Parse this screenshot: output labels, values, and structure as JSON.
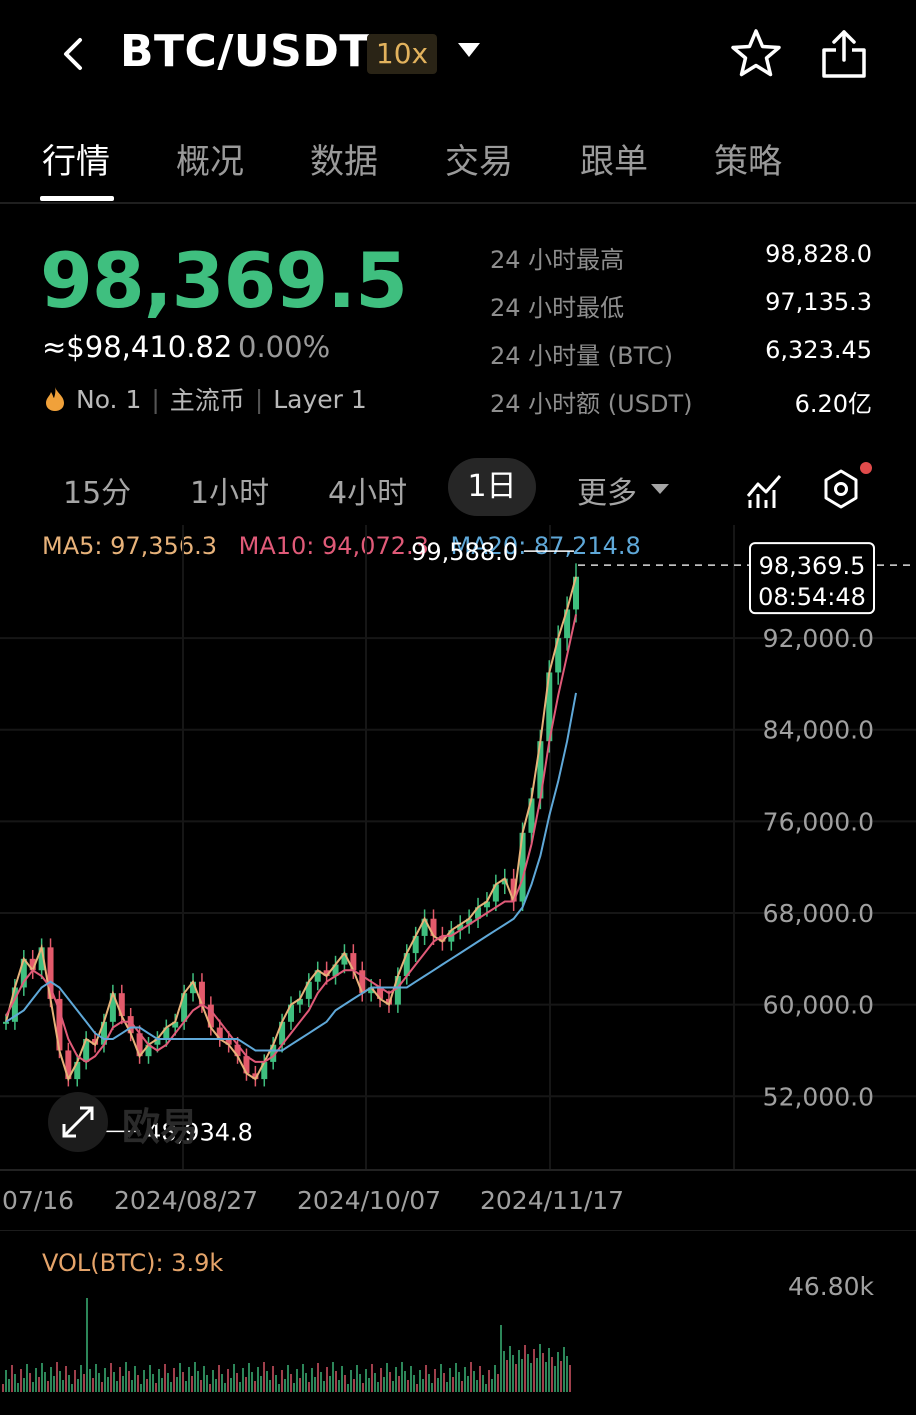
{
  "header": {
    "pair": "BTC/USDT",
    "leverage": "10x"
  },
  "tabs": [
    "行情",
    "概况",
    "数据",
    "交易",
    "跟单",
    "策略"
  ],
  "price": {
    "last": "98,369.5",
    "fiat": "≈$98,410.82",
    "change": "0.00%",
    "rank": "No. 1",
    "tag1": "主流币",
    "tag2": "Layer 1"
  },
  "stats": [
    {
      "label": "24 小时最高",
      "value": "98,828.0"
    },
    {
      "label": "24 小时最低",
      "value": "97,135.3"
    },
    {
      "label": "24 小时量 (BTC)",
      "value": "6,323.45"
    },
    {
      "label": "24 小时额 (USDT)",
      "value": "6.20亿"
    }
  ],
  "timeframes": {
    "m15": "15分",
    "h1": "1小时",
    "h4": "4小时",
    "d1": "1日",
    "more": "更多"
  },
  "ma": {
    "ma5": "MA5: 97,356.3",
    "ma10": "MA10: 94,072.3",
    "ma20": "MA20: 87,214.8"
  },
  "colors": {
    "up": "#3fbf7f",
    "down": "#e35a6b",
    "ma5": "#e7b27a",
    "ma10": "#e05a78",
    "ma20": "#5fa8d8",
    "accent": "#e2b25d"
  },
  "chart_data": {
    "type": "line",
    "title": "",
    "y_ticks": [
      "92,000.0",
      "84,000.0",
      "76,000.0",
      "68,000.0",
      "60,000.0",
      "52,000.0"
    ],
    "x_ticks": [
      "07/16",
      "2024/08/27",
      "2024/10/07",
      "2024/11/17"
    ],
    "ylim": [
      46000,
      101000
    ],
    "high_label": "99,588.0",
    "low_label": "48,934.8",
    "current_price": "98,369.5",
    "current_time": "08:54:48",
    "series": [
      {
        "name": "MA5",
        "values": [
          58500,
          61500,
          64000,
          63000,
          65000,
          60500,
          56000,
          53500,
          55000,
          57000,
          56500,
          58500,
          61000,
          59000,
          57500,
          55500,
          56500,
          57000,
          58000,
          58500,
          61000,
          62000,
          60000,
          58000,
          57000,
          56500,
          55500,
          54000,
          53500,
          55000,
          56500,
          58500,
          60000,
          60500,
          62000,
          63000,
          62500,
          63500,
          64500,
          63000,
          61000,
          61500,
          60500,
          60000,
          62500,
          64500,
          66000,
          67500,
          66000,
          65500,
          66500,
          67000,
          67500,
          68500,
          69000,
          70500,
          71000,
          69000,
          75000,
          78000,
          83000,
          89000,
          92000,
          94500,
          97356
        ]
      },
      {
        "name": "MA10",
        "values": [
          59000,
          60500,
          62000,
          63000,
          62500,
          61500,
          59500,
          57000,
          55500,
          55000,
          55500,
          56500,
          58000,
          58500,
          58500,
          57500,
          56500,
          56000,
          56500,
          57500,
          58500,
          59500,
          60000,
          59500,
          58500,
          57500,
          56500,
          55500,
          55000,
          55000,
          55500,
          56500,
          57500,
          58500,
          59500,
          61000,
          62000,
          62500,
          63000,
          63000,
          62500,
          62000,
          61500,
          61000,
          61500,
          62500,
          63500,
          64500,
          65500,
          66000,
          66000,
          66500,
          67000,
          67500,
          68000,
          68500,
          69000,
          69000,
          71000,
          74000,
          78000,
          83000,
          87000,
          90500,
          94072
        ]
      },
      {
        "name": "MA20",
        "values": [
          58500,
          59000,
          59500,
          60500,
          61500,
          62000,
          61500,
          60500,
          59500,
          58500,
          57500,
          57000,
          57000,
          57500,
          58000,
          58000,
          57500,
          57000,
          57000,
          57000,
          57000,
          57000,
          57000,
          57000,
          57000,
          57000,
          57000,
          56500,
          56000,
          56000,
          56000,
          56000,
          56500,
          57000,
          57500,
          58000,
          58500,
          59500,
          60000,
          60500,
          61000,
          61500,
          61500,
          61500,
          61500,
          61500,
          62000,
          62500,
          63000,
          63500,
          64000,
          64500,
          65000,
          65500,
          66000,
          66500,
          67000,
          67500,
          68500,
          70500,
          73000,
          76500,
          79500,
          83000,
          87214
        ]
      }
    ]
  },
  "volume": {
    "title": "VOL(BTC): 3.9k",
    "max_label": "46.80k"
  },
  "watermark": "欧易"
}
